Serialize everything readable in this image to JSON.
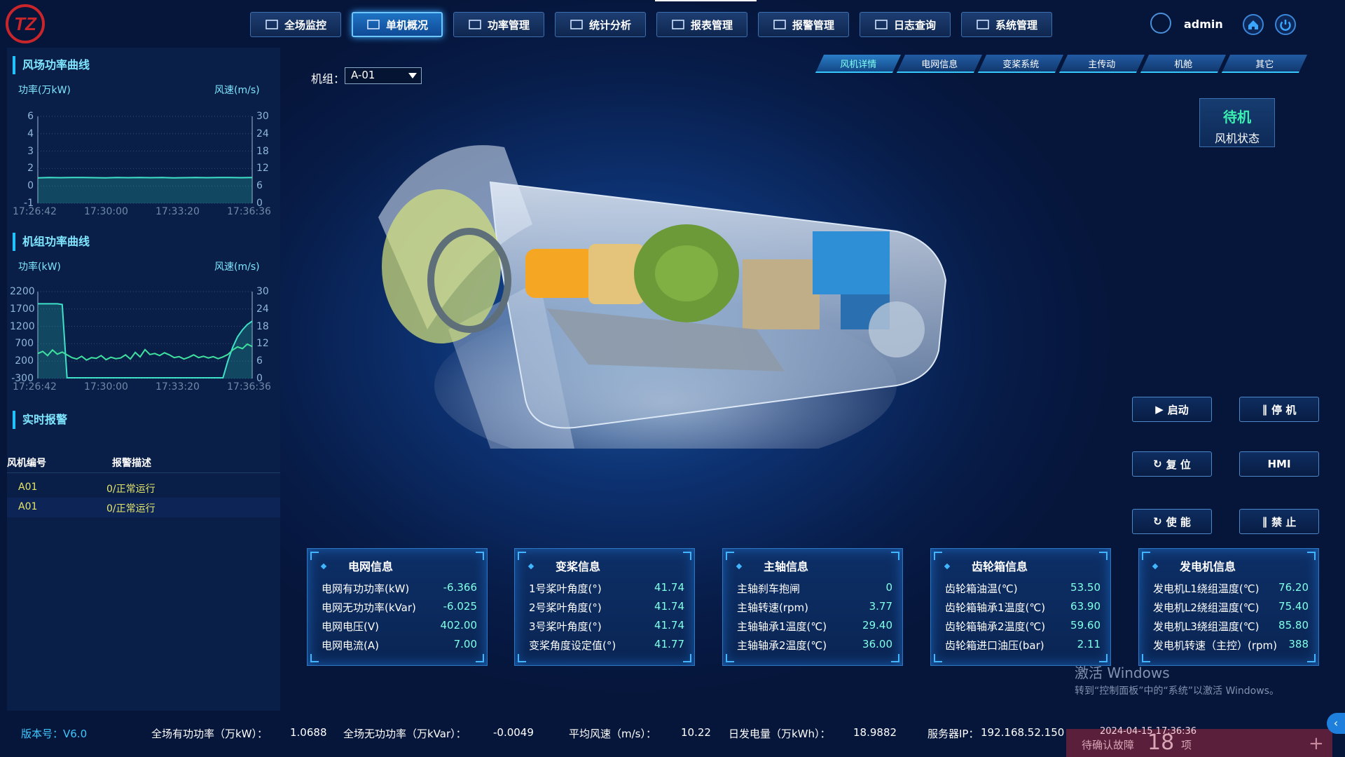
{
  "header": {
    "nav": [
      {
        "label": "全场监控",
        "icon": "monitor-icon"
      },
      {
        "label": "单机概况",
        "icon": "grid-icon",
        "active": true
      },
      {
        "label": "功率管理",
        "icon": "power-icon"
      },
      {
        "label": "统计分析",
        "icon": "bar-chart-icon"
      },
      {
        "label": "报表管理",
        "icon": "clipboard-icon"
      },
      {
        "label": "报警管理",
        "icon": "warning-icon"
      },
      {
        "label": "日志查询",
        "icon": "log-icon"
      },
      {
        "label": "系统管理",
        "icon": "users-icon"
      }
    ],
    "user": "admin"
  },
  "left": {
    "farm_title": "风场功率曲线",
    "unit_title": "机组功率曲线",
    "alarm_title": "实时报警",
    "alarm_cols": [
      "风机编号",
      "报警描述"
    ],
    "alarms": [
      {
        "id": "A01",
        "desc": "0/正常运行"
      },
      {
        "id": "A01",
        "desc": "0/正常运行"
      }
    ]
  },
  "chart_data": [
    {
      "type": "line",
      "title": "风场功率曲线",
      "ylabel": "功率(万kW)",
      "y2label": "风速(m/s)",
      "x": [
        "17:26:42",
        "17:30:00",
        "17:33:20",
        "17:36:36"
      ],
      "yticks": [
        "6",
        "4",
        "3",
        "2",
        "0",
        "-1"
      ],
      "y2ticks": [
        "30",
        "24",
        "18",
        "12",
        "6",
        "0"
      ],
      "series": [
        {
          "values": [
            1.05,
            1.07,
            1.06,
            1.08,
            1.07,
            1.06,
            1.05,
            1.07,
            1.06,
            1.08,
            1.06,
            1.07,
            1.05,
            1.06,
            1.07,
            1.06,
            1.08,
            1.07,
            1.06,
            1.07
          ]
        }
      ]
    },
    {
      "type": "line",
      "title": "机组功率曲线",
      "ylabel": "功率(kW)",
      "y2label": "风速(m/s)",
      "x": [
        "17:26:42",
        "17:30:00",
        "17:33:20",
        "17:36:36"
      ],
      "yticks": [
        "2200",
        "1700",
        "1200",
        "700",
        "200",
        "-300"
      ],
      "y2ticks": [
        "30",
        "24",
        "18",
        "12",
        "6",
        "0"
      ],
      "series": [
        {
          "values": [
            1850,
            1850,
            1850,
            1850,
            1850,
            1830,
            -280,
            -280,
            -280,
            -280,
            -280,
            -280,
            -280,
            -280,
            -280,
            -280,
            -280,
            -280,
            -280,
            -280,
            -280,
            -280,
            -280,
            -280,
            -280,
            -280,
            -280,
            -280,
            -280,
            -280,
            -280,
            -280,
            -280,
            -280,
            -280,
            -280,
            -280,
            -280,
            -280,
            200,
            600,
            900,
            1100,
            1250,
            1350
          ]
        },
        {
          "values": [
            420,
            480,
            360,
            520,
            400,
            460,
            380,
            300,
            260,
            340,
            230,
            300,
            280,
            360,
            240,
            310,
            270,
            290,
            380,
            260,
            450,
            320,
            530,
            390,
            420,
            360,
            440,
            380,
            300,
            330,
            260,
            310,
            380,
            300,
            340,
            290,
            330,
            270,
            320,
            390,
            520,
            610,
            560,
            690,
            620
          ]
        }
      ]
    }
  ],
  "main": {
    "unit_label": "机组：",
    "unit_value": "A-01",
    "subtabs": [
      "风机详情",
      "电网信息",
      "变桨系统",
      "主传动",
      "机舱",
      "其它"
    ],
    "status_value": "待机",
    "status_label": "风机状态",
    "controls": {
      "start": "启动",
      "stop": "停 机",
      "reset": "复 位",
      "hmi": "HMI",
      "enable": "使 能",
      "forbid": "禁 止"
    }
  },
  "cards": [
    {
      "title": "电网信息",
      "rows": [
        {
          "k": "电网有功功率(kW)",
          "v": "-6.366"
        },
        {
          "k": "电网无功功率(kVar)",
          "v": "-6.025"
        },
        {
          "k": "电网电压(V)",
          "v": "402.00"
        },
        {
          "k": "电网电流(A)",
          "v": "7.00"
        }
      ]
    },
    {
      "title": "变桨信息",
      "rows": [
        {
          "k": "1号桨叶角度(°)",
          "v": "41.74"
        },
        {
          "k": "2号桨叶角度(°)",
          "v": "41.74"
        },
        {
          "k": "3号桨叶角度(°)",
          "v": "41.74"
        },
        {
          "k": "变桨角度设定值(°)",
          "v": "41.77"
        }
      ]
    },
    {
      "title": "主轴信息",
      "rows": [
        {
          "k": "主轴刹车抱闸",
          "v": "0"
        },
        {
          "k": "主轴转速(rpm)",
          "v": "3.77"
        },
        {
          "k": "主轴轴承1温度(℃)",
          "v": "29.40"
        },
        {
          "k": "主轴轴承2温度(℃)",
          "v": "36.00"
        }
      ]
    },
    {
      "title": "齿轮箱信息",
      "rows": [
        {
          "k": "齿轮箱油温(℃)",
          "v": "53.50"
        },
        {
          "k": "齿轮箱轴承1温度(℃)",
          "v": "63.90"
        },
        {
          "k": "齿轮箱轴承2温度(℃)",
          "v": "59.60"
        },
        {
          "k": "齿轮箱进口油压(bar)",
          "v": "2.11"
        }
      ]
    },
    {
      "title": "发电机信息",
      "rows": [
        {
          "k": "发电机L1绕组温度(℃)",
          "v": "76.20"
        },
        {
          "k": "发电机L2绕组温度(℃)",
          "v": "75.40"
        },
        {
          "k": "发电机L3绕组温度(℃)",
          "v": "85.80"
        },
        {
          "k": "发电机转速（主控）(rpm)",
          "v": "388"
        }
      ]
    }
  ],
  "footer": {
    "version": "版本号：V6.0",
    "active_power_label": "全场有功功率（万kW）：",
    "active_power": "1.0688",
    "reactive_power_label": "全场无功功率（万kVar）：",
    "reactive_power": "-0.0049",
    "wind_label": "平均风速（m/s）：",
    "wind": "10.22",
    "energy_label": "日发电量（万kWh）：",
    "energy": "18.9882",
    "server_label": "服务器IP：",
    "server": "192.168.52.150",
    "datetime": "2024-04-15 17:36:36",
    "pending_label": "待确认故障",
    "pending_count": "18",
    "pending_unit": "项"
  },
  "watermark": {
    "line1": "激活 Windows",
    "line2": "转到“控制面板”中的“系统”以激活 Windows。"
  },
  "colors": {
    "accent": "#1fc3ff",
    "value": "#7fffe6",
    "status_ok": "#3af0b0",
    "alarm_text": "#e6e66a"
  }
}
